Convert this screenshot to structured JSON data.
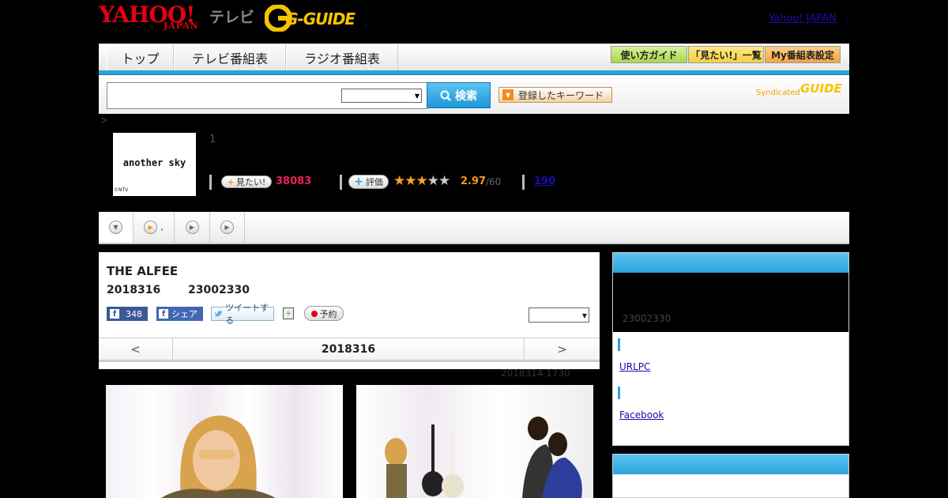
{
  "header": {
    "yahoo_logo": "YAHOO!",
    "yahoo_japan": "JAPAN",
    "tv_label": "テレビ",
    "gguide_logo": "G-GUIDE",
    "separator": ",",
    "yahoo_japan_link": "Yahoo! JAPAN",
    "trailing_comma": ","
  },
  "nav": {
    "tabs": [
      "トップ",
      "テレビ番組表",
      "ラジオ番組表"
    ],
    "buttons": [
      "使い方ガイド",
      "「見たい!」一覧",
      "My番組表設定"
    ],
    "button_colors": [
      "#a8d84a",
      "#f7cf3d",
      "#f7a23d"
    ]
  },
  "search": {
    "input_value": "",
    "select_value": "",
    "button_label": "検索",
    "keyword_label": "登録したキーワード",
    "syndicated": "Syndicated",
    "syndicated_logo": "GUIDE"
  },
  "breadcrumb": ">",
  "program": {
    "thumb_title": "another sky",
    "thumb_copy": "©NTV",
    "number": "1",
    "mitai_label": "見たい!",
    "mitai_count": "38083",
    "hyoka_label": "評価",
    "rating": 2.5,
    "rating_value": "2.97",
    "rating_den": "/60",
    "reviews": "190"
  },
  "tabs_strip": {
    "middle_text": ","
  },
  "episode": {
    "title": "THE ALFEE",
    "date": "2018316",
    "time": "23002330",
    "fb_count": "348",
    "fb_share": "シェア",
    "tweet": "ツイートする",
    "reserve": "予約",
    "select_value": "",
    "nav_prev": "<",
    "nav_date": "2018316",
    "nav_next": ">",
    "updated": "2018314  1730"
  },
  "side": {
    "time": "23002330",
    "url_link": "URLPC",
    "facebook_link": "Facebook"
  }
}
